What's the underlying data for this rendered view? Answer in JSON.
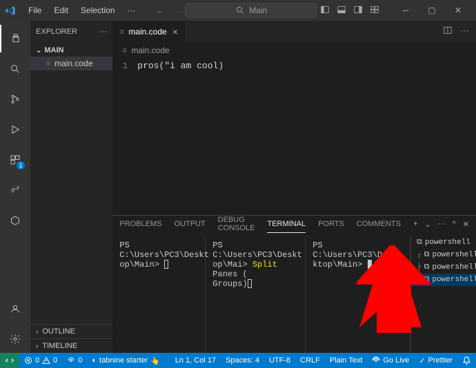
{
  "menu": {
    "file": "File",
    "edit": "Edit",
    "selection": "Selection",
    "more": "···"
  },
  "search": {
    "text": "Main"
  },
  "sidebar": {
    "title": "EXPLORER",
    "section": "MAIN",
    "file": "main.code",
    "outline": "OUTLINE",
    "timeline": "TIMELINE"
  },
  "tab": {
    "label": "main.code"
  },
  "breadcrumb": {
    "file": "main.code"
  },
  "code": {
    "line1_num": "1",
    "line1": "pros(\"i am cool)"
  },
  "panel": {
    "problems": "PROBLEMS",
    "output": "OUTPUT",
    "debug": "DEBUG CONSOLE",
    "terminal": "TERMINAL",
    "ports": "PORTS",
    "comments": "COMMENTS"
  },
  "terminals": {
    "p1a": "PS C:\\Users\\PC3\\Deskt",
    "p1b": "op\\Main> ",
    "p2a": "PS C:\\Users\\PC3\\Deskt",
    "p2b": "op\\Mai> ",
    "p2c": "Split",
    "p2d": " Panes (",
    "p2e": "Groups)",
    "p3a": "PS C:\\Users\\PC3\\Des",
    "p3b": "ktop\\Main> "
  },
  "termlist": {
    "r1": "powershell",
    "r2": "powershell",
    "r3": "powershell",
    "r4": "powershell"
  },
  "status": {
    "errors": "0",
    "warnings": "0",
    "ports": "0",
    "tabnine": "tabnine starter",
    "ln": "Ln 1, Col 17",
    "spaces": "Spaces: 4",
    "encoding": "UTF-8",
    "eol": "CRLF",
    "lang": "Plain Text",
    "golive": "Go Live",
    "prettier": "Prettier"
  },
  "activity_badge": "1"
}
